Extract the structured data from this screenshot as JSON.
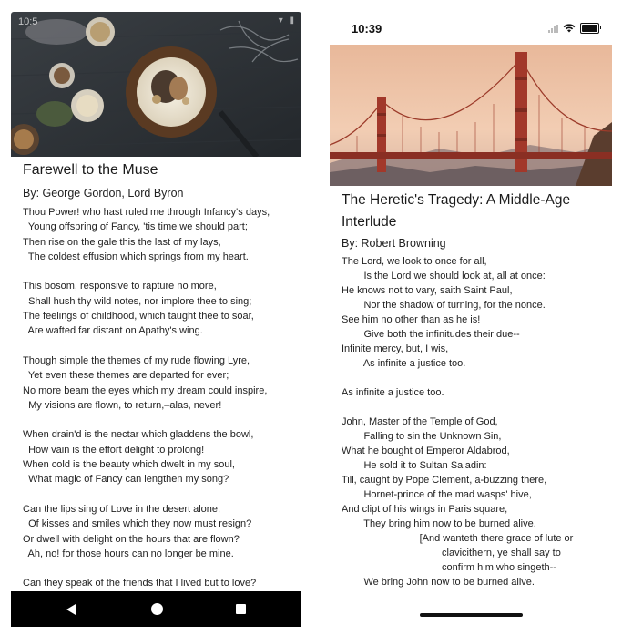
{
  "android": {
    "status": {
      "time": "10:5",
      "icons": "▾ ▮"
    },
    "title": "Farewell to the Muse",
    "author": "By: George Gordon, Lord Byron",
    "poem": "Thou Power! who hast ruled me through Infancy's days,\n  Young offspring of Fancy, 'tis time we should part;\nThen rise on the gale this the last of my lays,\n  The coldest effusion which springs from my heart.\n\nThis bosom, responsive to rapture no more,\n  Shall hush thy wild notes, nor implore thee to sing;\nThe feelings of childhood, which taught thee to soar,\n  Are wafted far distant on Apathy's wing.\n\nThough simple the themes of my rude flowing Lyre,\n  Yet even these themes are departed for ever;\nNo more beam the eyes which my dream could inspire,\n  My visions are flown, to return,–alas, never!\n\nWhen drain'd is the nectar which gladdens the bowl,\n  How vain is the effort delight to prolong!\nWhen cold is the beauty which dwelt in my soul,\n  What magic of Fancy can lengthen my song?\n\nCan the lips sing of Love in the desert alone,\n  Of kisses and smiles which they now must resign?\nOr dwell with delight on the hours that are flown?\n  Ah, no! for those hours can no longer be mine.\n\nCan they speak of the friends that I lived but to love?",
    "nav": {
      "back_icon": "back-triangle",
      "home_icon": "home-circle",
      "recents_icon": "recents-square"
    }
  },
  "ios": {
    "status": {
      "time": "10:39"
    },
    "title": "The Heretic's Tragedy: A Middle-Age Interlude",
    "author": "By: Robert Browning",
    "poem": "The Lord, we look to once for all,\n        Is the Lord we should look at, all at once:\nHe knows not to vary, saith Saint Paul,\n        Nor the shadow of turning, for the nonce.\nSee him no other than as he is!\n        Give both the infinitudes their due--\nInfinite mercy, but, I wis,\n        As infinite a justice too.\n\nAs infinite a justice too.\n\nJohn, Master of the Temple of God,\n        Falling to sin the Unknown Sin,\nWhat he bought of Emperor Aldabrod,\n        He sold it to Sultan Saladin:\nTill, caught by Pope Clement, a-buzzing there,\n        Hornet-prince of the mad wasps' hive,\nAnd clipt of his wings in Paris square,\n        They bring him now to be burned alive.\n                            [And wanteth there grace of lute or\n                                    clavicithern, ye shall say to\n                                    confirm him who singeth--\n        We bring John now to be burned alive."
  }
}
